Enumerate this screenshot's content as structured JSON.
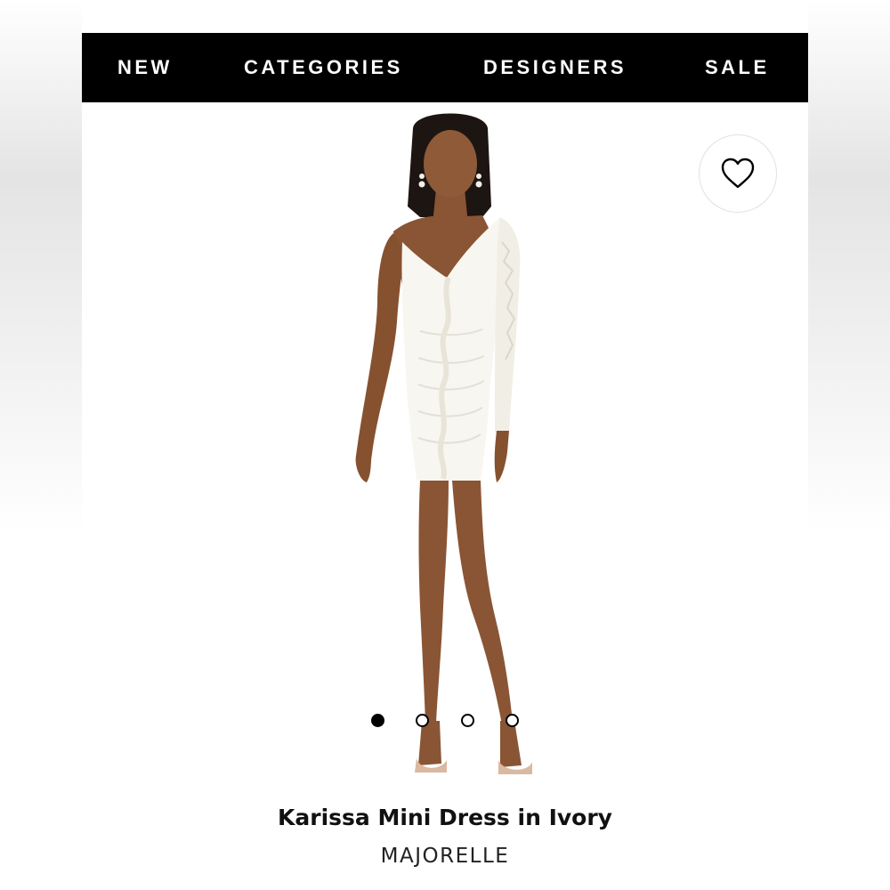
{
  "nav": {
    "items": [
      {
        "label": "NEW"
      },
      {
        "label": "CATEGORIES"
      },
      {
        "label": "DESIGNERS"
      },
      {
        "label": "SALE"
      }
    ]
  },
  "wishlist": {
    "icon": "heart-outline-icon"
  },
  "carousel": {
    "total": 4,
    "active_index": 1
  },
  "product": {
    "title": "Karissa Mini Dress in Ivory",
    "brand": "MAJORELLE",
    "image": "model-wearing-white-one-shoulder-lace-sleeve-mini-dress"
  },
  "colors": {
    "nav_background": "#000000",
    "nav_text": "#ffffff",
    "dress": "#f8f6f0",
    "skin": "#8a5534"
  }
}
